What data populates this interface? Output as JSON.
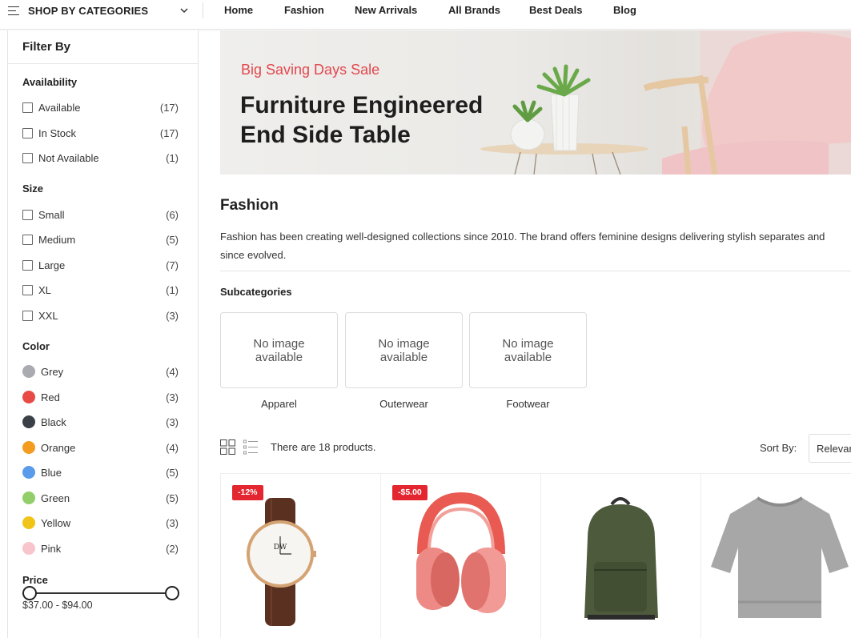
{
  "nav": {
    "categories_label": "SHOP BY CATEGORIES",
    "links": [
      "Home",
      "Fashion",
      "New Arrivals",
      "All Brands",
      "Best Deals",
      "Blog"
    ]
  },
  "sidebar": {
    "title": "Filter By",
    "availability": {
      "title": "Availability",
      "items": [
        {
          "label": "Available",
          "count": "(17)"
        },
        {
          "label": "In Stock",
          "count": "(17)"
        },
        {
          "label": "Not Available",
          "count": "(1)"
        }
      ]
    },
    "size": {
      "title": "Size",
      "items": [
        {
          "label": "Small",
          "count": "(6)"
        },
        {
          "label": "Medium",
          "count": "(5)"
        },
        {
          "label": "Large",
          "count": "(7)"
        },
        {
          "label": "XL",
          "count": "(1)"
        },
        {
          "label": "XXL",
          "count": "(3)"
        }
      ]
    },
    "color": {
      "title": "Color",
      "items": [
        {
          "label": "Grey",
          "count": "(4)",
          "swatch": "#a9abb0"
        },
        {
          "label": "Red",
          "count": "(3)",
          "swatch": "#e84b45"
        },
        {
          "label": "Black",
          "count": "(3)",
          "swatch": "#3b3f47"
        },
        {
          "label": "Orange",
          "count": "(4)",
          "swatch": "#f39c1f"
        },
        {
          "label": "Blue",
          "count": "(5)",
          "swatch": "#5b9bec"
        },
        {
          "label": "Green",
          "count": "(5)",
          "swatch": "#92cf6b"
        },
        {
          "label": "Yellow",
          "count": "(3)",
          "swatch": "#f0c419"
        },
        {
          "label": "Pink",
          "count": "(2)",
          "swatch": "#f7c5cb"
        }
      ]
    },
    "price": {
      "title": "Price",
      "range_text": "$37.00 - $94.00"
    }
  },
  "banner": {
    "sale_text": "Big Saving Days Sale",
    "headline_line1": "Furniture Engineered",
    "headline_line2": "End Side Table"
  },
  "category": {
    "title": "Fashion",
    "description_line1": "Fashion has been creating well-designed collections since 2010. The brand offers feminine designs delivering stylish separates and",
    "description_line2": "since evolved."
  },
  "subcategories": {
    "title": "Subcategories",
    "placeholder_line1": "No image",
    "placeholder_line2": "available",
    "items": [
      "Apparel",
      "Outerwear",
      "Footwear"
    ]
  },
  "toolbar": {
    "product_count_text": "There are 18 products.",
    "sort_label": "Sort By:",
    "sort_value": "Relevance"
  },
  "products": [
    {
      "badge": "-12%",
      "image": "wristwatch"
    },
    {
      "badge": "-$5.00",
      "image": "headphones"
    },
    {
      "badge": "",
      "image": "backpack"
    },
    {
      "badge": "",
      "image": "sweater"
    }
  ],
  "colors": {
    "accent_red": "#e3262f",
    "sale_text": "#e2474d"
  }
}
